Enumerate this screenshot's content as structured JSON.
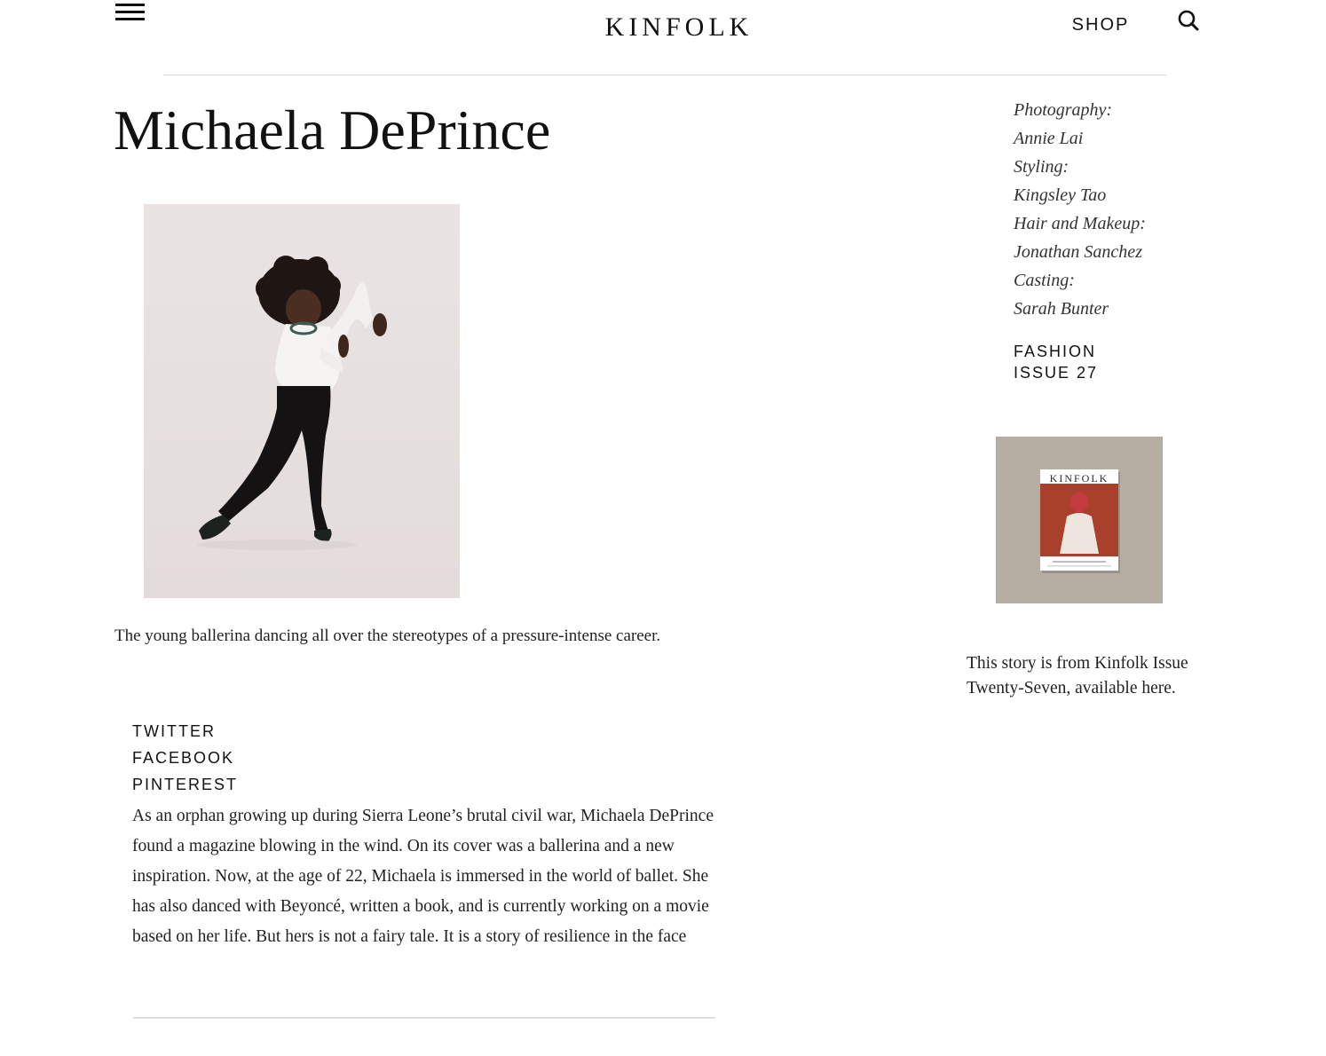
{
  "header": {
    "logo": "KINFOLK",
    "shop_label": "SHOP",
    "menu_icon": "hamburger-menu-icon",
    "search_icon": "search-icon"
  },
  "article": {
    "title": "Michaela DePrince",
    "dek": "The young ballerina dancing all over the stereotypes of a pressure-intense career.",
    "body": "As an orphan growing up during Sierra Leone’s brutal civil war, Michaela DePrince found a magazine blowing in the wind. On its cover was a ballerina and a new inspiration. Now, at the age of 22, Michaela is immersed in the world of ballet. She has also danced with Beyoncé, written a book, and is currently working on a movie based on her life. But hers is not a fairy tale. It is a story of resilience in the face"
  },
  "social": {
    "twitter": "TWITTER",
    "facebook": "FACEBOOK",
    "pinterest": "PINTEREST"
  },
  "sidebar": {
    "credits": [
      "Photography:",
      "Annie Lai",
      "Styling:",
      "Kingsley Tao",
      "Hair and Makeup:",
      "Jonathan Sanchez",
      "Casting:",
      "Sarah Bunter"
    ],
    "category": "FASHION",
    "issue": "ISSUE 27",
    "cover_logo": "KINFOLK",
    "promo_text": "This story is from Kinfolk Issue Twenty-Seven, available here."
  },
  "colors": {
    "text": "#1b1b1b",
    "rule": "#dadada",
    "issue_bg": "#b6ada3",
    "cover_red": "#a8402c"
  }
}
